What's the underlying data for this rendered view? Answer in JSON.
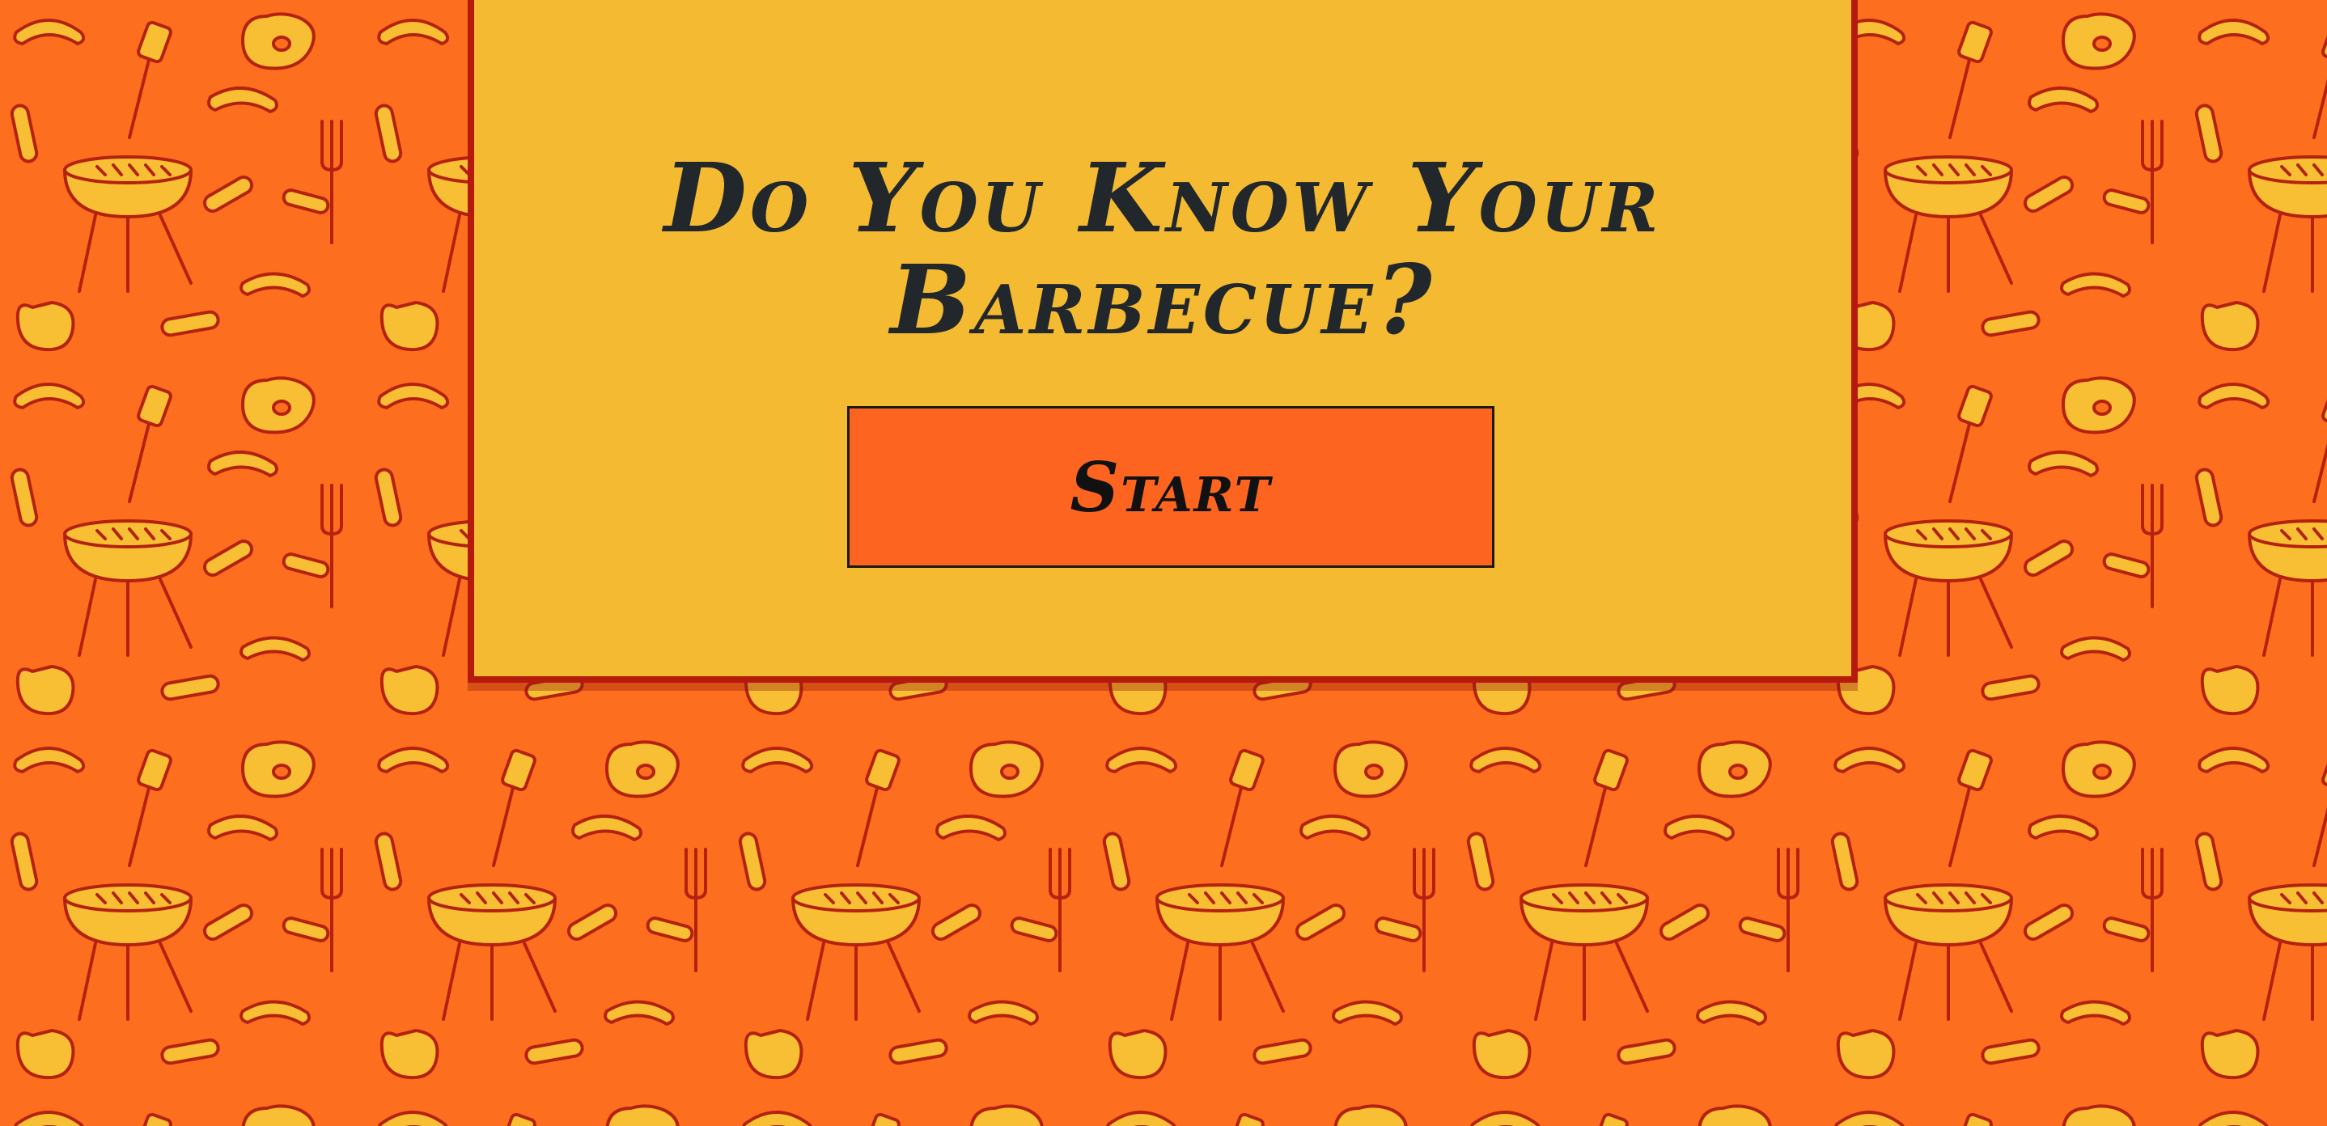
{
  "page": {
    "title_line1": "Do You Know Your",
    "title_line2": "Barbecue?",
    "start_label": "Start"
  },
  "theme": {
    "background": "#fd6f1f",
    "pattern_fill": "#f8bf34",
    "pattern_stroke": "#b4220f",
    "panel": "#f4bb32",
    "panel_border": "#b61a0c",
    "button": "#fd6420",
    "title_text": "#22272b"
  },
  "background_pattern": {
    "icons": [
      "grill-icon",
      "sausage-icon",
      "steak-icon",
      "fork-icon",
      "spatula-icon",
      "tongs-icon"
    ]
  }
}
